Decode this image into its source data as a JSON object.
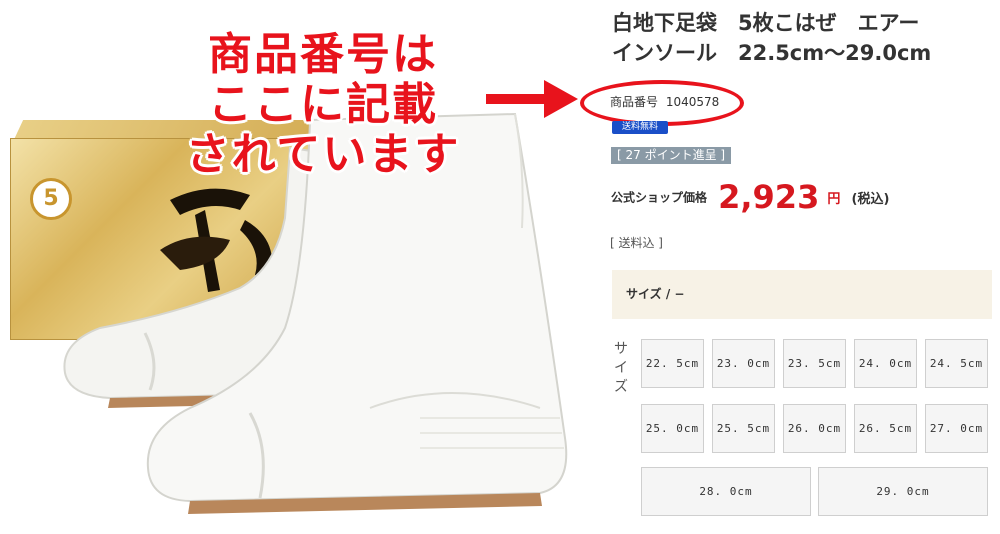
{
  "annotation": {
    "lines": [
      "商品番号は",
      "ここに記載",
      "されています"
    ],
    "color": "#e8131c"
  },
  "product": {
    "title_line1": "白地下足袋　5枚こはぜ　エアー",
    "title_line2": "インソール　22.5cm〜29.0cm",
    "number_label": "商品番号",
    "number_value": "1040578",
    "shipping_badge": "送料無料",
    "points": "[ 27 ポイント進呈 ]",
    "price_label": "公式ショップ価格",
    "price_value": "2,923",
    "price_unit": "円",
    "price_tax": "(税込)",
    "shipping_note": "[ 送料込 ]"
  },
  "box": {
    "number": "5"
  },
  "size_selector": {
    "header": "サイズ / −",
    "vertical_label": [
      "サ",
      "イ",
      "ズ"
    ],
    "options": [
      "22. 5cm",
      "23. 0cm",
      "23. 5cm",
      "24. 0cm",
      "24. 5cm",
      "25. 0cm",
      "25. 5cm",
      "26. 0cm",
      "26. 5cm",
      "27. 0cm",
      "28. 0cm",
      "29. 0cm"
    ]
  },
  "colors": {
    "accent_red": "#d6181f",
    "size_header_bg": "#f7f2e6",
    "points_badge_bg": "#8a9aa6",
    "shipping_badge_bg": "#1a4fc8"
  },
  "icons": {
    "arrow": "right-arrow-icon"
  }
}
